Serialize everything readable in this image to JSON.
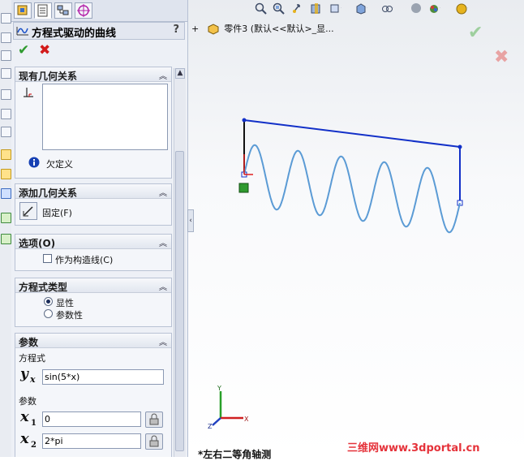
{
  "left_strip": {
    "icons": [
      "sketch-tool-icon",
      "sketch-tool-icon",
      "sketch-tool-icon",
      "sketch-tool-icon",
      "sketch-tool-icon",
      "sketch-tool-icon",
      "sketch-tool-icon"
    ]
  },
  "property_manager": {
    "tabs": [
      "feature-manager-icon",
      "property-manager-icon",
      "configuration-manager-icon",
      "dimxpert-icon"
    ],
    "title": "方程式驱动的曲线",
    "help": "?",
    "ok_symbol": "✔",
    "cancel_symbol": "✖",
    "sections": {
      "existing_relations": {
        "title": "现有几何关系",
        "status": "欠定义",
        "collapse": "︽"
      },
      "add_relations": {
        "title": "添加几何关系",
        "fix_label": "固定(F)",
        "collapse": "︽"
      },
      "options": {
        "title": "选项(O)",
        "construction_label": "作为构造线(C)",
        "construction_checked": false,
        "collapse": "︽"
      },
      "equation_type": {
        "title": "方程式类型",
        "explicit": "显性",
        "parametric": "参数性",
        "selected": "explicit",
        "collapse": "︽"
      },
      "parameters": {
        "title": "参数",
        "collapse": "︽",
        "equation_label": "方程式",
        "yx_value": "sin(5*x)",
        "params_label": "参数",
        "x1_value": "0",
        "x2_value": "2*pi"
      }
    }
  },
  "graphics": {
    "tree_text": "零件3  (默认<<默认>_显...",
    "view_name": "*左右二等角轴测",
    "watermark": "三维网www.3dportal.cn",
    "toolbar_icons": [
      "zoom-to-fit-icon",
      "zoom-area-icon",
      "previous-view-icon",
      "section-view-icon",
      "view-orientation-icon",
      "display-style-icon",
      "hide-show-icon",
      "edit-appearance-icon",
      "apply-scene-icon",
      "view-settings-icon"
    ],
    "confirm_symbol": "✔",
    "cancel_symbol": "✖",
    "curve_color": "#5b9bd5",
    "line_color": "#1230c8",
    "triad_labels": {
      "x": "X",
      "y": "Y",
      "z": "Z"
    }
  }
}
